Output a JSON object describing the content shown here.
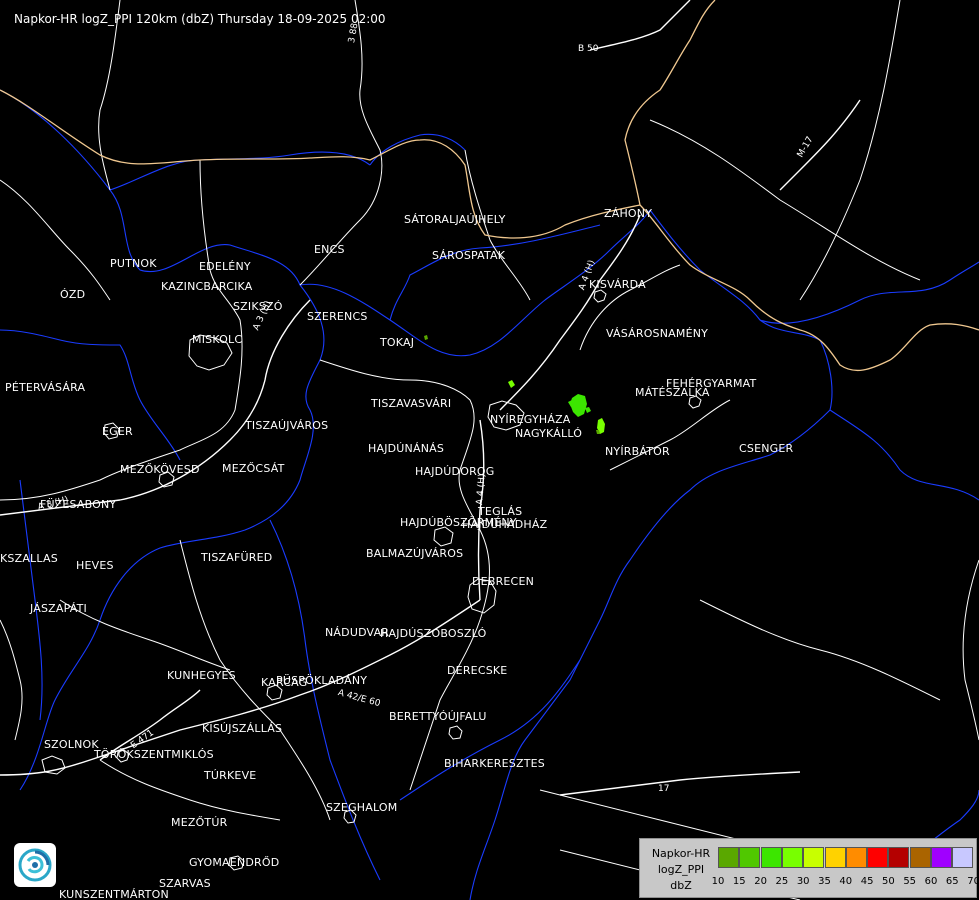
{
  "header": {
    "title": "Napkor-HR logZ_PPI 120km (dbZ) Thursday 18-09-2025 02:00"
  },
  "cities": [
    "SÁTORALJAÚJHELY",
    "SÁROSPATAK",
    "ZÁHONY",
    "KISVÁRDA",
    "PUTNOK",
    "EDELÉNY",
    "KAZINCBARCIKA",
    "ÓZD",
    "ENCS",
    "SZIKSZÓ",
    "SZERENCS",
    "TOKAJ",
    "MISKOLC",
    "VÁSÁROSNAMÉNY",
    "FEHÉRGYARMAT",
    "MÁTÉSZALKA",
    "PÉTERVÁSÁRA",
    "TISZAVASVÁRI",
    "NYÍREGYHÁZA",
    "NAGYKÁLLÓ",
    "EGER",
    "TISZAÚJVÁROS",
    "HAJDÚNÁNÁS",
    "NYÍRBÁTOR",
    "CSENGER",
    "MEZŐKÖVESD",
    "MEZŐCSÁT",
    "HAJDÚDOROG",
    "FÜZESABONY",
    "TEGLÁS",
    "HAJDÚBÖSZÖRMÉNY",
    "HAJDÚHADHÁZ",
    "BALMAZÚJVÁROS",
    "TISZAFÜRED",
    "KSZALLAS",
    "HEVES",
    "DEBRECEN",
    "JÁSZAPÁTI",
    "NÁDUDVAR",
    "HAJDÚSZOBOSZLÓ",
    "KUNHEGYES",
    "DERECSKE",
    "KARCAG",
    "PÜSPÖKLADÁNY",
    "BERETTYÓÚJFALU",
    "KISÚJSZÁLLÁS",
    "SZOLNOK",
    "TÖRÖKSZENTMIKLÓS",
    "BIHARKERESZTES",
    "TÚRKEVE",
    "SZEGHALOM",
    "MEZŐTÚR",
    "GYOMAENDRŐD",
    "SZARVAS",
    "KUNSZENTMÁRTON"
  ],
  "roads": [
    "3 88",
    "B 50",
    "M-17",
    "A 4 (H)",
    "A 3 (H)",
    "A 4 (H)",
    "A 3 (H)",
    "A 42/E 60",
    "E 471",
    "17"
  ],
  "legend": {
    "title_lines": [
      "Napkor-HR",
      "logZ_PPI",
      "dbZ"
    ],
    "ticks": [
      "10",
      "15",
      "20",
      "25",
      "30",
      "35",
      "40",
      "45",
      "50",
      "55",
      "60",
      "65",
      "70"
    ],
    "colors": [
      "#5aa800",
      "#50c800",
      "#3ce600",
      "#78ff00",
      "#c8ff00",
      "#ffd200",
      "#ff8c00",
      "#ff0000",
      "#b40000",
      "#aa6400",
      "#a000ff",
      "#c8c8ff"
    ]
  },
  "echoes": [
    {
      "dbz": 20,
      "color": "#3ce600"
    },
    {
      "dbz": 25,
      "color": "#78ff00"
    },
    {
      "dbz": 10,
      "color": "#5aa800"
    }
  ],
  "map_colors": {
    "background": "#000000",
    "county_lines": "#ffffff",
    "rivers": "#2040ff",
    "national_border": "#f0c890"
  },
  "logo_icon": "radar-logo-icon"
}
